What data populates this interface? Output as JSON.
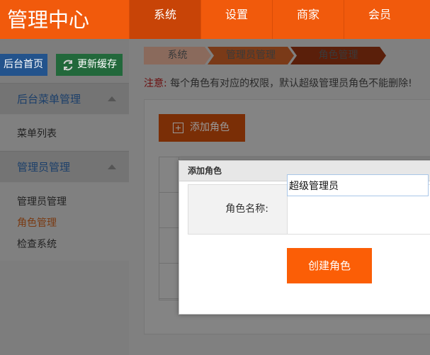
{
  "header": {
    "logo": "管理中心",
    "nav": [
      {
        "label": "系统",
        "active": true
      },
      {
        "label": "设置"
      },
      {
        "label": "商家"
      },
      {
        "label": "会员"
      }
    ]
  },
  "sidebar": {
    "home_button": "后台首页",
    "cache_button": "更新缓存",
    "sections": [
      {
        "title": "后台菜单管理",
        "items": [
          "菜单列表"
        ]
      },
      {
        "title": "管理员管理",
        "items": [
          "管理员管理",
          "角色管理",
          "检查系统"
        ],
        "active_item": "角色管理"
      }
    ]
  },
  "main": {
    "breadcrumb": [
      "系统",
      "管理员管理",
      "角色管理"
    ],
    "notice_label": "注意:",
    "notice_text": "每个角色有对应的权限，默认超级管理员角色不能删除!",
    "add_button": "添加角色"
  },
  "modal": {
    "title": "添加角色",
    "field_label": "角色名称:",
    "field_value": "超级管理员",
    "submit_label": "创建角色"
  },
  "colors": {
    "brand": "#f15a0c",
    "submit": "#fb5e06",
    "link_blue": "#23538c",
    "cache_green": "#22683b"
  }
}
